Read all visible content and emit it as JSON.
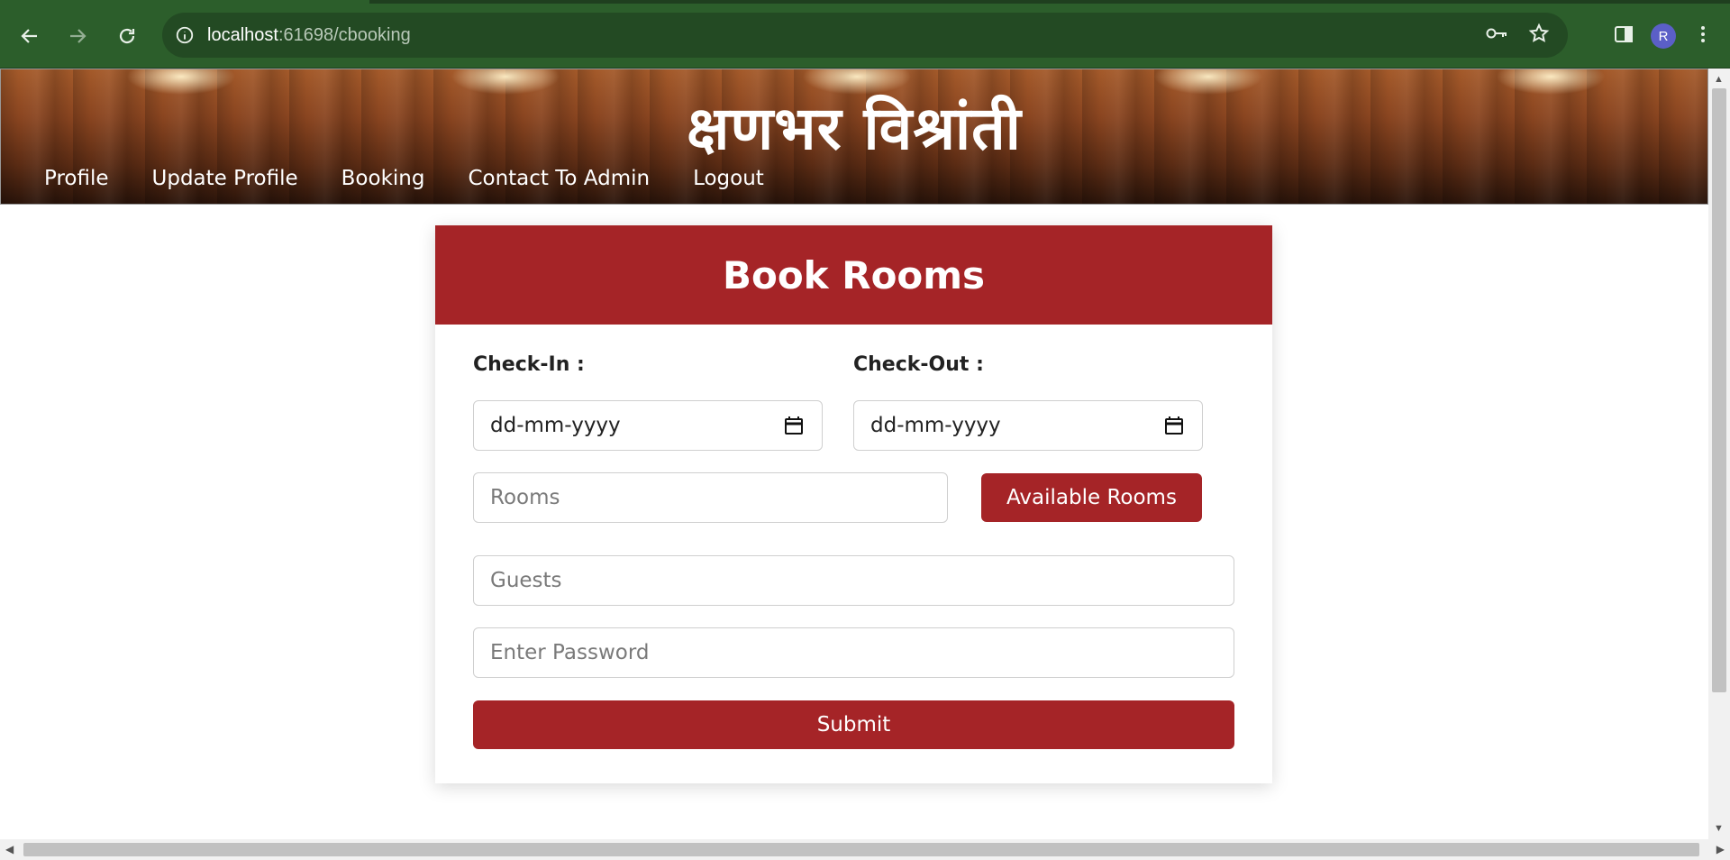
{
  "browser": {
    "url_host": "localhost",
    "url_rest": ":61698/cbooking",
    "profile_initial": "R"
  },
  "site": {
    "title": "क्षणभर विश्रांती",
    "menu": [
      "Profile",
      "Update Profile",
      "Booking",
      "Contact To Admin",
      "Logout"
    ]
  },
  "form": {
    "heading": "Book Rooms",
    "checkin_label": "Check-In :",
    "checkout_label": "Check-Out :",
    "checkin_value": "dd-mm-yyyy",
    "checkout_value": "dd-mm-yyyy",
    "rooms_placeholder": "Rooms",
    "available_rooms_label": "Available Rooms",
    "guests_placeholder": "Guests",
    "password_placeholder": "Enter Password",
    "submit_label": "Submit"
  },
  "colors": {
    "brand_red": "#a52427",
    "chrome_green": "#2c5e2b"
  }
}
